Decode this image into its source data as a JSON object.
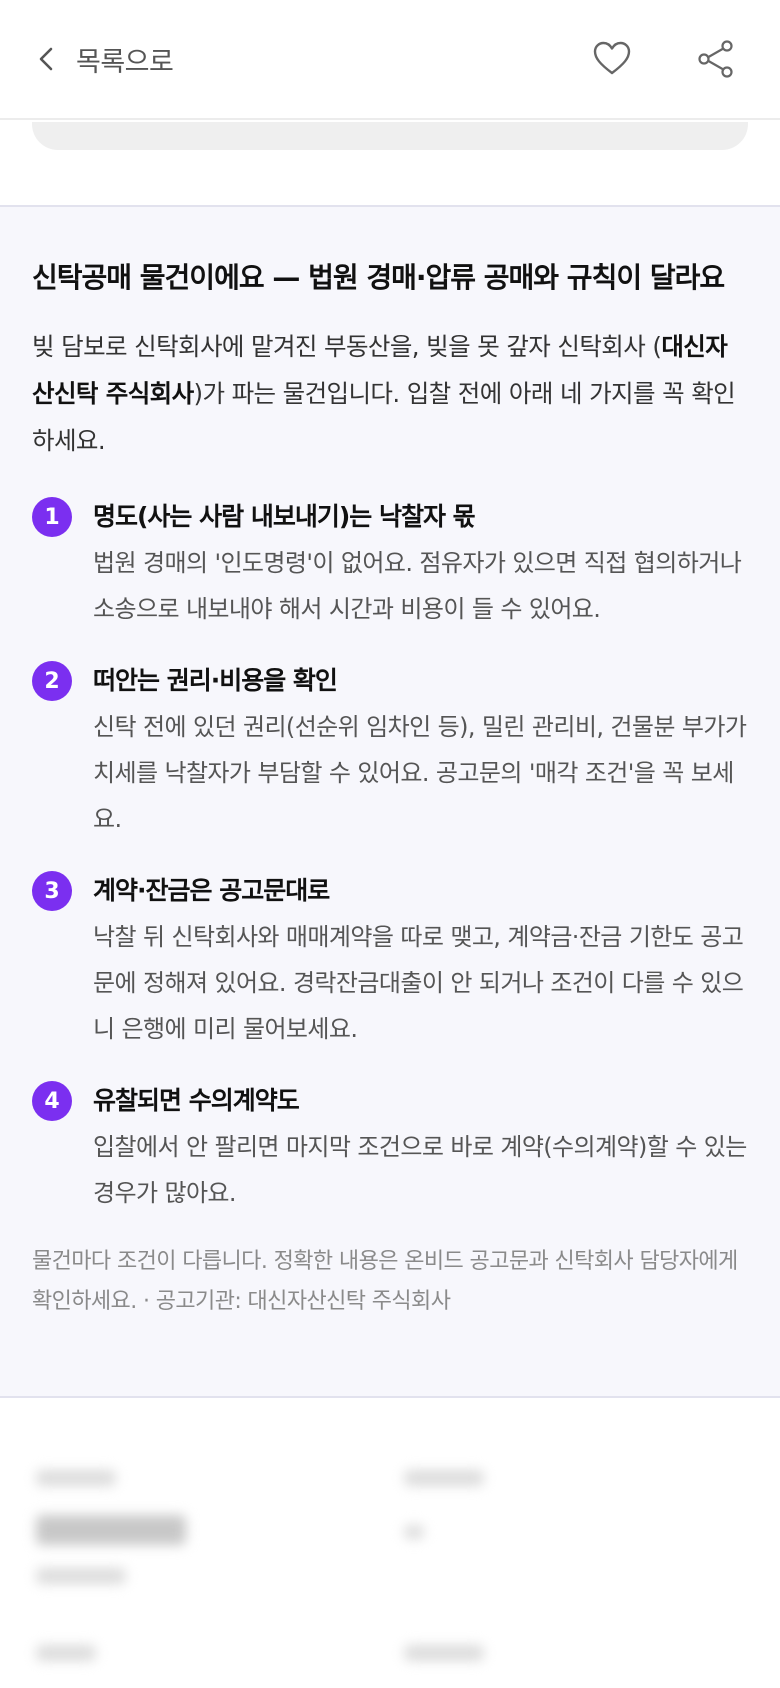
{
  "header": {
    "back_label": "목록으로",
    "back_icon": "chevron-left-icon",
    "favorite_icon": "heart-icon",
    "share_icon": "share-icon"
  },
  "notice": {
    "title": "신탁공매 물건이에요 — 법원 경매·압류 공매와 규칙이 달라요",
    "intro_before": "빚 담보로 신탁회사에 맡겨진 부동산을, 빚을 못 갚자 신탁회사 (",
    "intro_company": "대신자산신탁 주식회사",
    "intro_after": ")가 파는 물건입니다. 입찰 전에 아래 네 가지를 꼭 확인하세요.",
    "items": [
      {
        "num": "1",
        "title": "명도(사는 사람 내보내기)는 낙찰자 몫",
        "desc": "법원 경매의 '인도명령'이 없어요. 점유자가 있으면 직접 협의하거나 소송으로 내보내야 해서 시간과 비용이 들 수 있어요."
      },
      {
        "num": "2",
        "title": "떠안는 권리·비용을 확인",
        "desc": "신탁 전에 있던 권리(선순위 임차인 등), 밀린 관리비, 건물분 부가가치세를 낙찰자가 부담할 수 있어요. 공고문의 '매각 조건'을 꼭 보세요."
      },
      {
        "num": "3",
        "title": "계약·잔금은 공고문대로",
        "desc": "낙찰 뒤 신탁회사와 매매계약을 따로 맺고, 계약금·잔금 기한도 공고문에 정해져 있어요. 경락잔금대출이 안 되거나 조건이 다를 수 있으니 은행에 미리 물어보세요."
      },
      {
        "num": "4",
        "title": "유찰되면 수의계약도",
        "desc": "입찰에서 안 팔리면 마지막 조건으로 바로 계약(수의계약)할 수 있는 경우가 많아요."
      }
    ],
    "footnote": "물건마다 조건이 다릅니다. 정확한 내용은 온비드 공고문과 신탁회사 담당자에게 확인하세요. · 공고기관: 대신자산신탁 주식회사"
  },
  "colors": {
    "accent": "#7b2ff0",
    "notice_bg": "#f7f7fc"
  }
}
